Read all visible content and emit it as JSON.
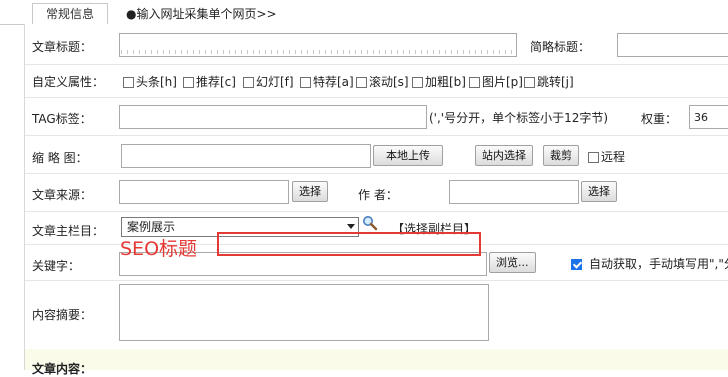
{
  "tabs": {
    "active": "常规信息",
    "second": "●输入网址采集单个网页>>"
  },
  "fields": {
    "title_label": "文章标题：",
    "short_title_label": "简略标题：",
    "custom_attr_label": "自定义属性：",
    "attrs": [
      "头条[h]",
      "推荐[c]",
      "幻灯[f]",
      "特荐[a]",
      "滚动[s]",
      "加粗[b]",
      "图片[p]",
      "跳转[j]"
    ],
    "tag_label": "TAG标签：",
    "tag_hint": "(','号分开，单个标签小于12字节)",
    "weight_label": "权重：",
    "weight_value": "36",
    "thumb_label": "缩 略 图：",
    "upload_button": "本地上传",
    "site_select_button": "站内选择",
    "crop_button": "裁剪",
    "remote_label": "远程",
    "source_label": "文章来源：",
    "select_button": "选择",
    "author_label": "作 者：",
    "author_select_button": "选择",
    "column_label": "文章主栏目：",
    "column_value": "案例展示",
    "sub_column_link": "【选择副栏目】",
    "keywords_label": "关键字：",
    "browse_button": "浏览...",
    "auto_fetch_label": "自动获取，手动填写用\",\"分",
    "summary_label": "内容摘要：",
    "content_label": "文章内容："
  },
  "annotation": {
    "text": "SEO标题",
    "color": "#e53935"
  }
}
